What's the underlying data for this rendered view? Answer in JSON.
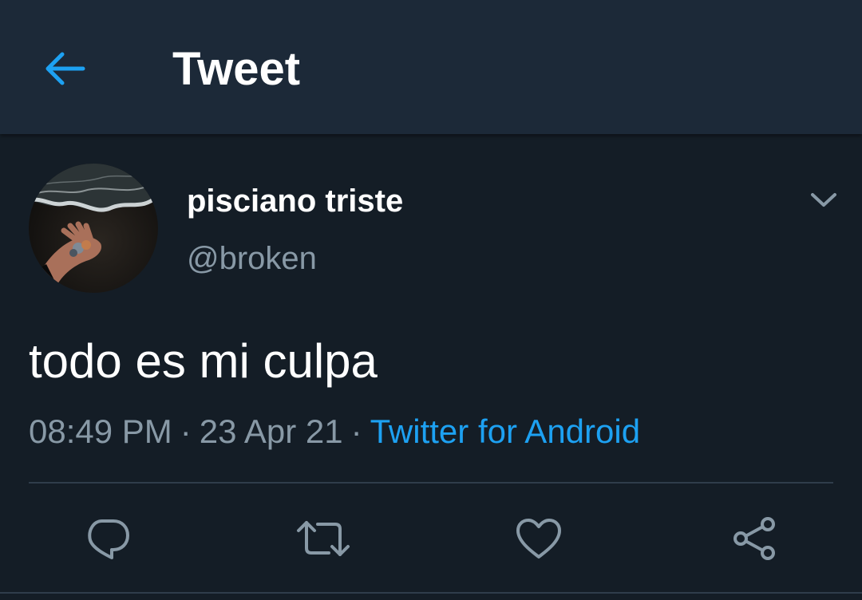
{
  "header": {
    "title": "Tweet",
    "back_icon": "arrow-left-icon"
  },
  "tweet": {
    "author": {
      "display_name": "pisciano triste",
      "handle": "@broken"
    },
    "menu_icon": "chevron-down-icon",
    "text": "todo es mi culpa",
    "time": "08:49 PM",
    "date": "23 Apr 21",
    "separator": "·",
    "source": "Twitter for Android"
  },
  "actions": [
    {
      "icon": "reply-icon"
    },
    {
      "icon": "retweet-icon"
    },
    {
      "icon": "like-icon"
    },
    {
      "icon": "share-icon"
    }
  ],
  "colors": {
    "background": "#141d26",
    "header_bg": "#1c2938",
    "accent": "#1da1f2",
    "secondary_text": "#8899a6",
    "primary_text": "#ffffff"
  }
}
